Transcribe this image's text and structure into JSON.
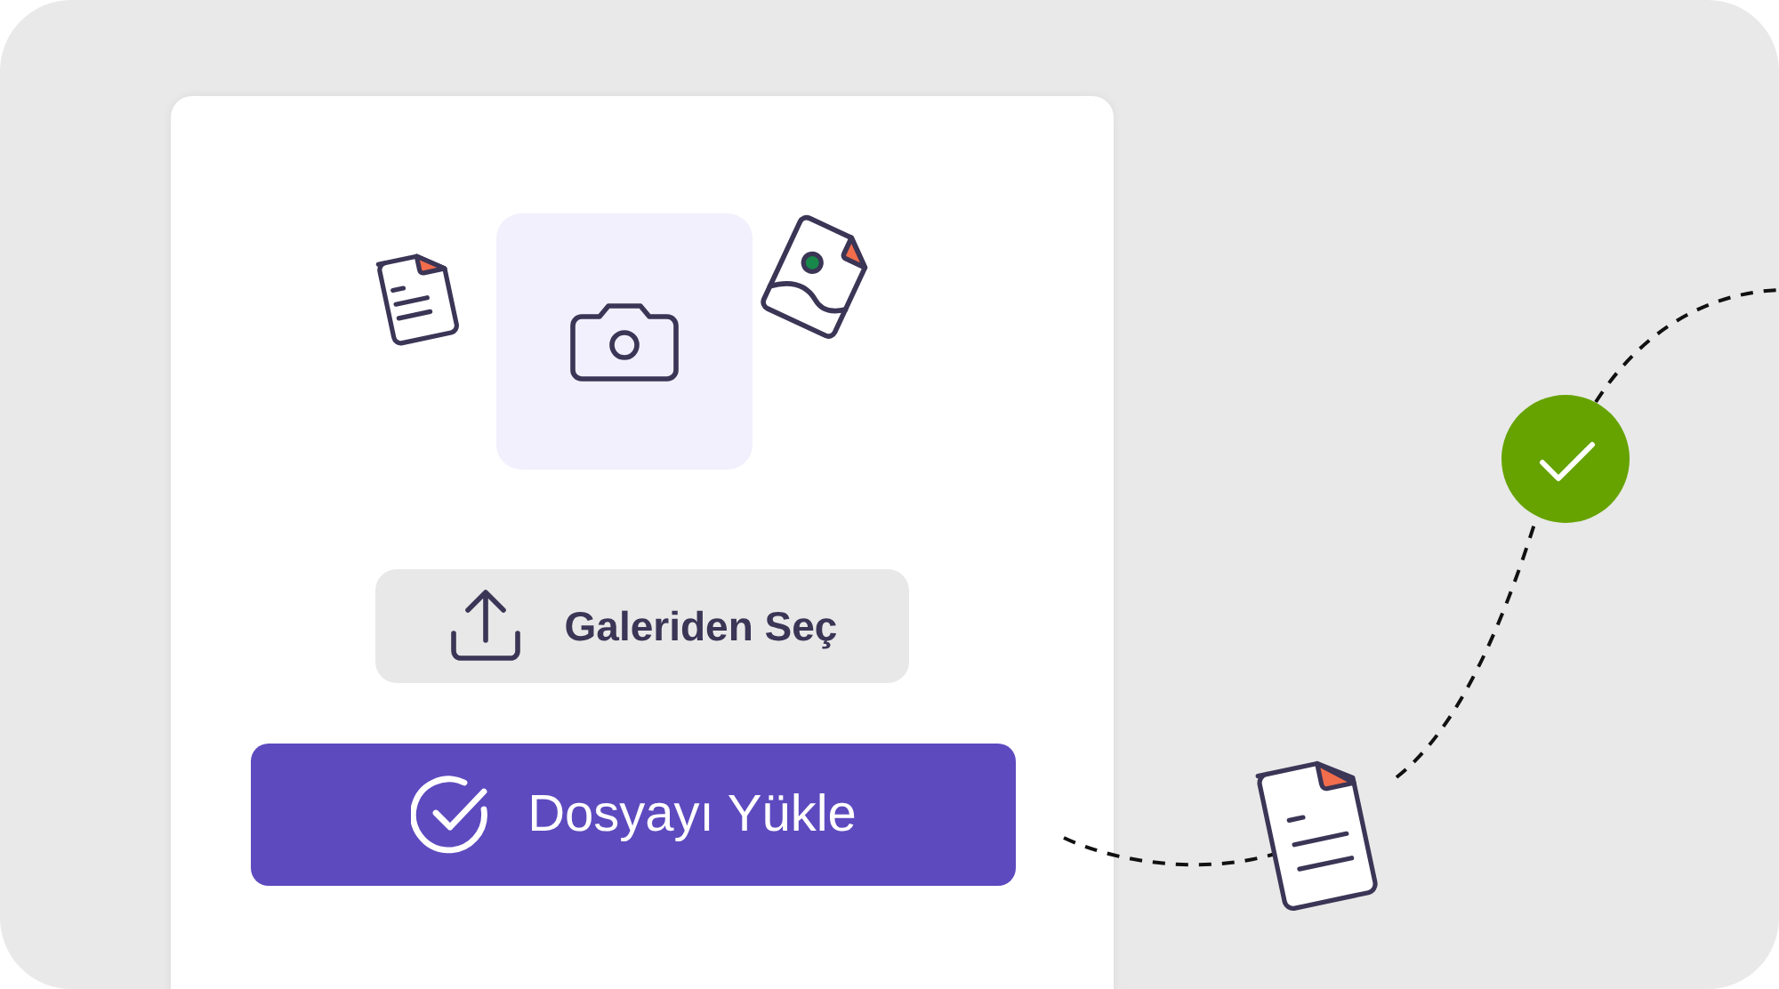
{
  "upload_card": {
    "gallery_button": {
      "label": "Galeriden Seç"
    },
    "upload_button": {
      "label": "Dosyayı Yükle"
    }
  }
}
